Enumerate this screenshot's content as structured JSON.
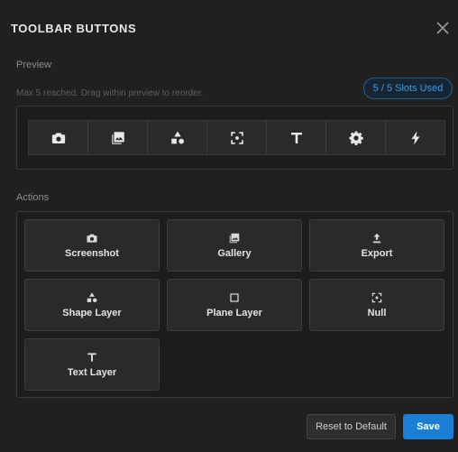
{
  "dialog": {
    "title": "TOOLBAR BUTTONS",
    "close_icon": "close-icon"
  },
  "preview": {
    "label": "Preview",
    "hint": "Max 5 reached. Drag within preview to reorder.",
    "slots_badge": "5 / 5 Slots Used",
    "slots": [
      {
        "icon": "camera-icon"
      },
      {
        "icon": "gallery-icon"
      },
      {
        "icon": "shapes-icon"
      },
      {
        "icon": "focus-icon"
      },
      {
        "icon": "text-icon"
      },
      {
        "icon": "gear-icon"
      },
      {
        "icon": "lightning-icon"
      }
    ]
  },
  "actions": {
    "label": "Actions",
    "items": [
      {
        "label": "Screenshot",
        "icon": "camera-icon"
      },
      {
        "label": "Gallery",
        "icon": "gallery-icon"
      },
      {
        "label": "Export",
        "icon": "export-icon"
      },
      {
        "label": "Shape Layer",
        "icon": "shapes-icon"
      },
      {
        "label": "Plane Layer",
        "icon": "square-icon"
      },
      {
        "label": "Null",
        "icon": "focus-icon"
      },
      {
        "label": "Text Layer",
        "icon": "text-icon"
      }
    ]
  },
  "footer": {
    "reset_label": "Reset to Default",
    "save_label": "Save"
  },
  "colors": {
    "accent": "#1a7fd4",
    "badge_text": "#3c9be0",
    "background": "#202020"
  }
}
